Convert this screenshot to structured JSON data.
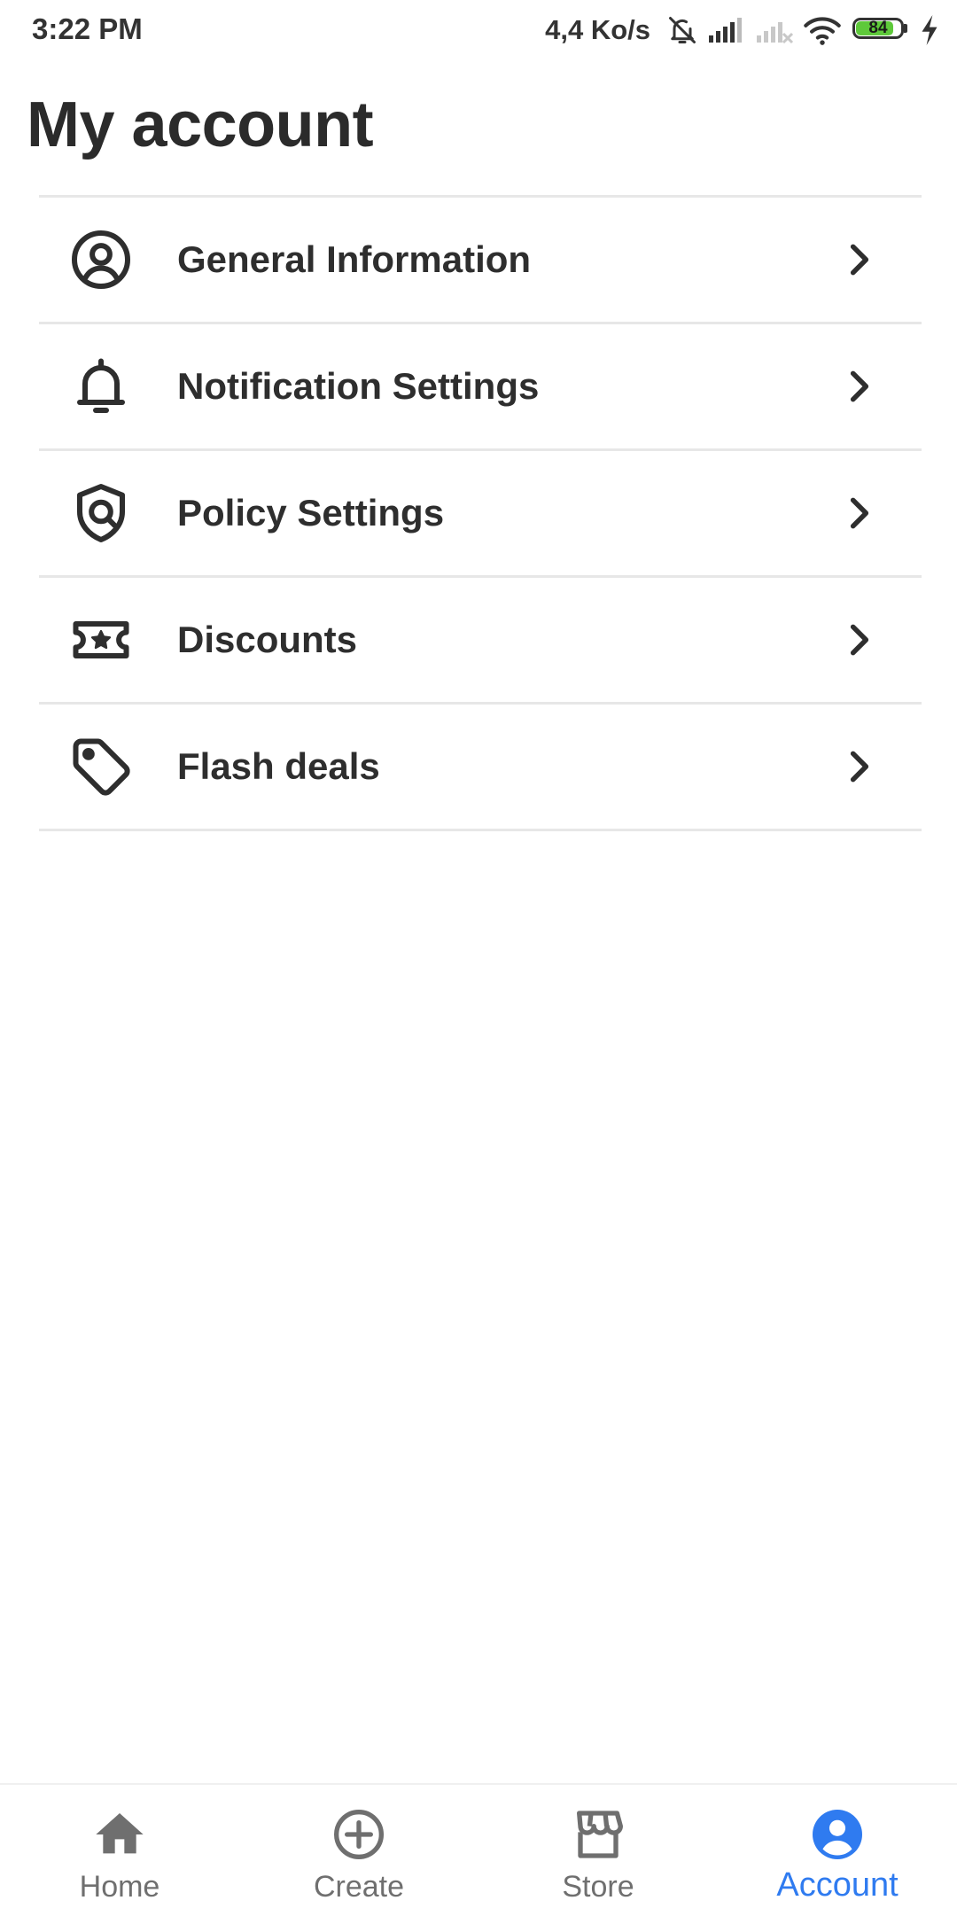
{
  "status_bar": {
    "time": "3:22 PM",
    "network_speed": "4,4 Ko/s",
    "battery_level": "84",
    "battery_fraction": 0.84,
    "icons": [
      "bell-muted-icon",
      "signal-icon",
      "signal-empty-icon",
      "wifi-icon",
      "battery-icon",
      "charging-icon"
    ]
  },
  "page": {
    "title": "My account"
  },
  "menu": {
    "items": [
      {
        "label": "General Information",
        "icon": "user-circle-icon"
      },
      {
        "label": "Notification Settings",
        "icon": "bell-icon"
      },
      {
        "label": "Policy Settings",
        "icon": "shield-icon"
      },
      {
        "label": "Discounts",
        "icon": "ticket-star-icon"
      },
      {
        "label": "Flash deals",
        "icon": "tag-icon"
      }
    ],
    "chevron_icon": "chevron-right-icon"
  },
  "bottom_nav": {
    "items": [
      {
        "label": "Home",
        "icon": "home-icon",
        "active": false
      },
      {
        "label": "Create",
        "icon": "plus-circle-icon",
        "active": false
      },
      {
        "label": "Store",
        "icon": "store-icon",
        "active": false
      },
      {
        "label": "Account",
        "icon": "account-icon",
        "active": true
      }
    ]
  },
  "colors": {
    "text": "#2b2b2b",
    "divider": "#e7e7e7",
    "nav_inactive": "#6f6f6f",
    "nav_active": "#2f7bf0",
    "battery_fill": "#5ec93a"
  }
}
